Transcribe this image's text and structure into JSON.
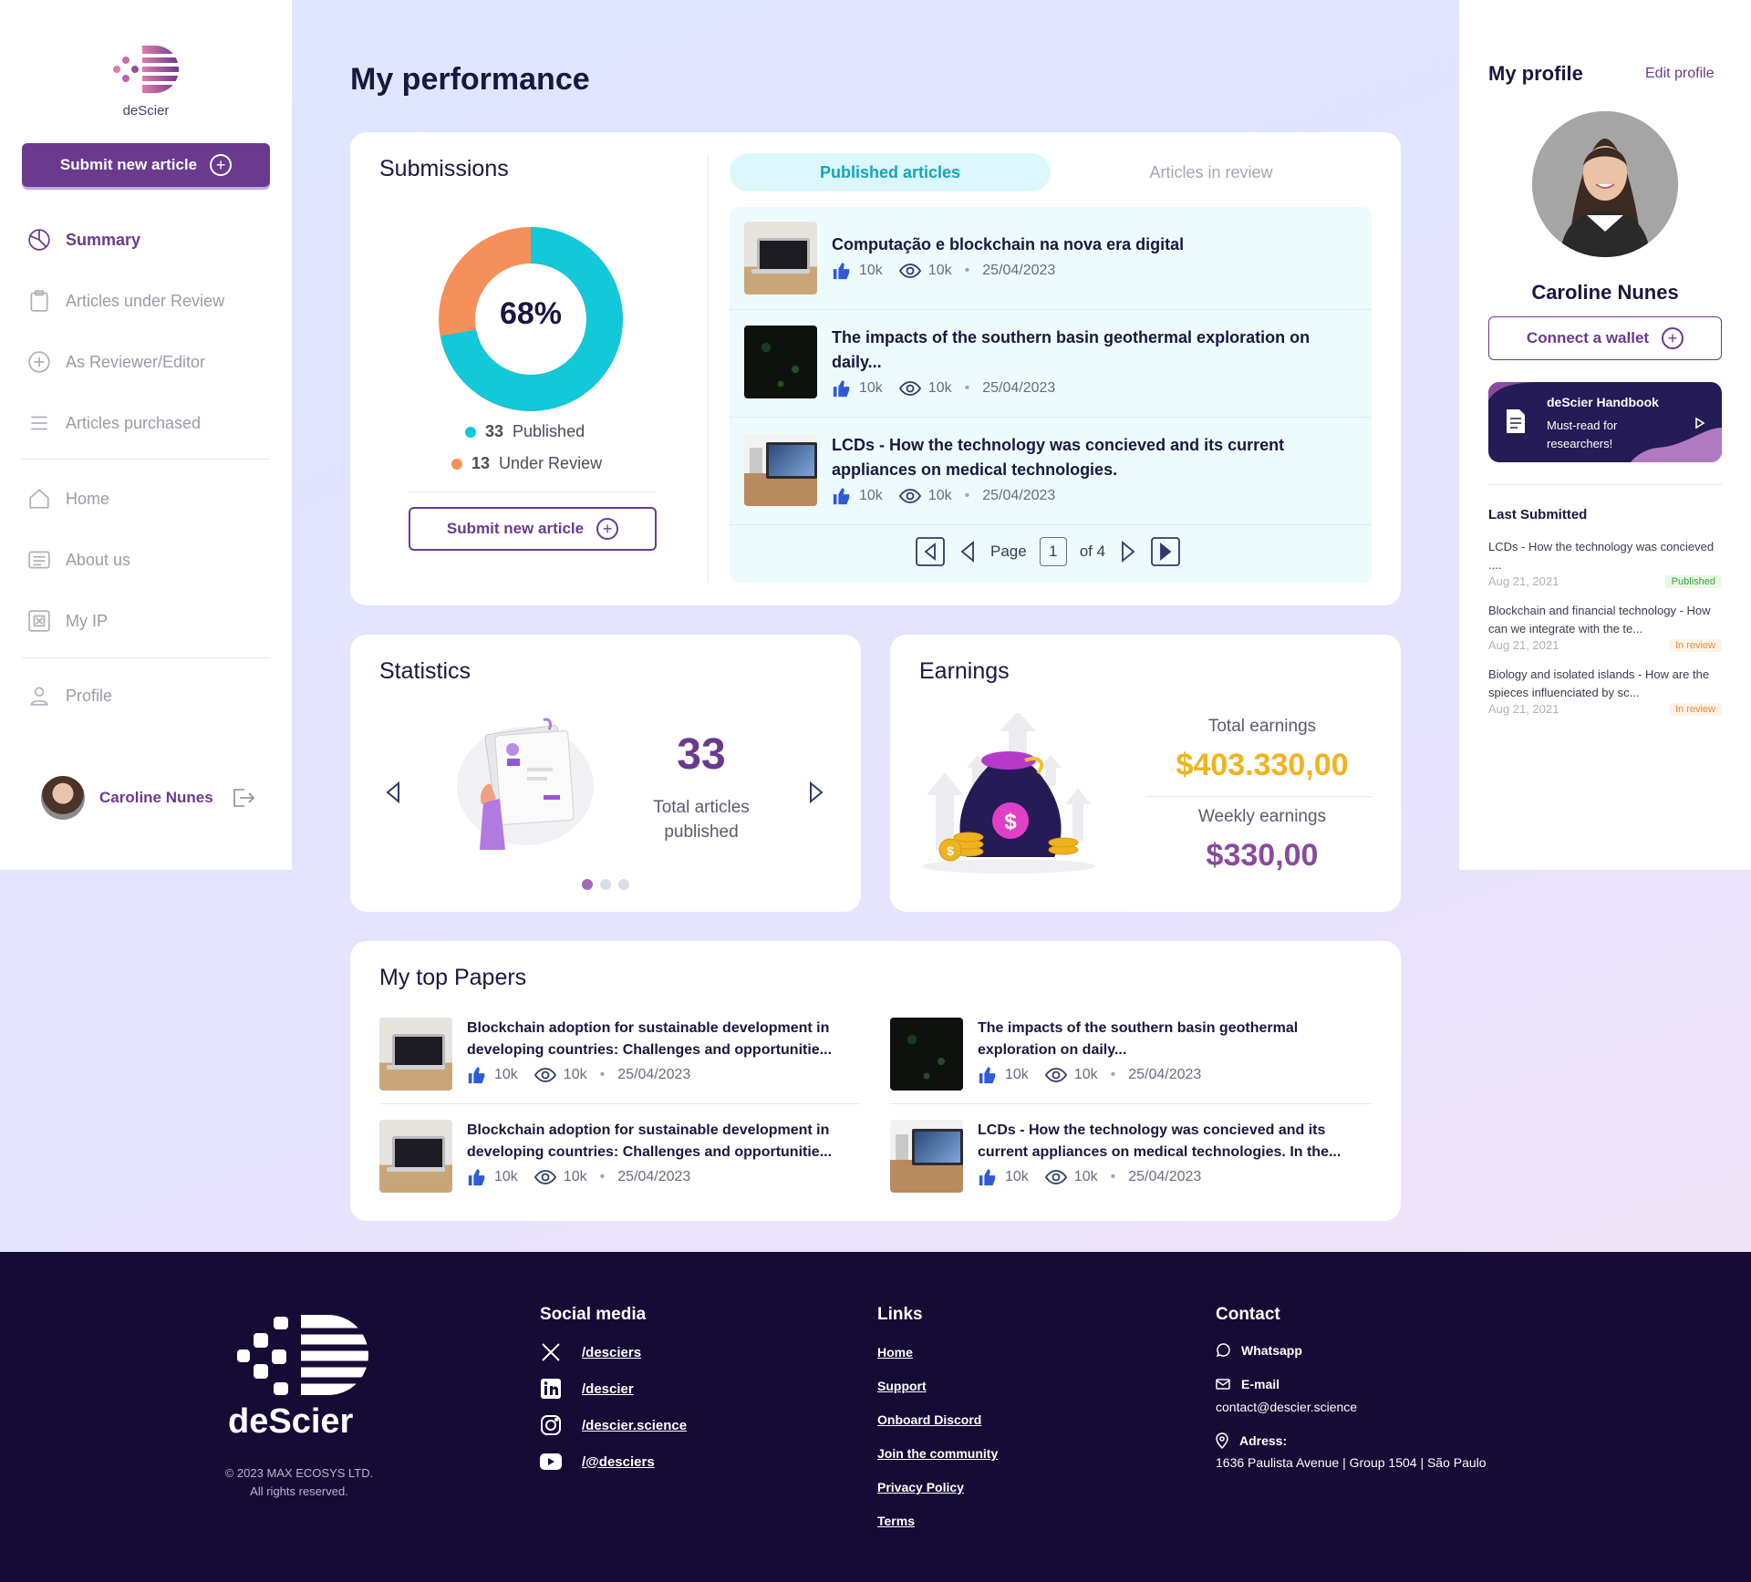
{
  "brand": {
    "name": "deScier",
    "accent": "#6a3a8f",
    "teal": "#13c8d8",
    "orange": "#f5905a",
    "gold": "#f0b320"
  },
  "sidebar": {
    "submit_label": "Submit new article",
    "nav": [
      {
        "label": "Summary",
        "icon": "pie-chart-icon",
        "active": true
      },
      {
        "label": "Articles under Review",
        "icon": "clipboard-icon"
      },
      {
        "label": "As Reviewer/Editor",
        "icon": "plus-circle-icon"
      },
      {
        "label": "Articles purchased",
        "icon": "list-icon"
      },
      {
        "label": "Home",
        "icon": "home-icon"
      },
      {
        "label": "About us",
        "icon": "document-icon"
      },
      {
        "label": "My IP",
        "icon": "ip-icon"
      },
      {
        "label": "Profile",
        "icon": "user-icon"
      }
    ],
    "user_name": "Caroline Nunes"
  },
  "main": {
    "title": "My performance",
    "submissions": {
      "title": "Submissions",
      "percent_label": "68%",
      "published_fraction": 0.72,
      "published_count": "33",
      "published_label": "Published",
      "review_count": "13",
      "review_label": "Under Review",
      "submit_label": "Submit new article"
    },
    "tabs": [
      {
        "label": "Published articles",
        "active": true
      },
      {
        "label": "Articles in review"
      }
    ],
    "articles": [
      {
        "title": "Computação e blockchain na nova era digital",
        "likes": "10k",
        "views": "10k",
        "date": "25/04/2023",
        "thumb": "laptop"
      },
      {
        "title": "The impacts of the southern basin geothermal exploration on daily...",
        "likes": "10k",
        "views": "10k",
        "date": "25/04/2023",
        "thumb": "dark"
      },
      {
        "title": "LCDs - How the technology was concieved and its current appliances on medical technologies.",
        "likes": "10k",
        "views": "10k",
        "date": "25/04/2023",
        "thumb": "desk"
      }
    ],
    "pagination": {
      "page_label": "Page",
      "current": "1",
      "of_label": "of 4"
    },
    "statistics": {
      "title": "Statistics",
      "number": "33",
      "caption": "Total articles published"
    },
    "earnings": {
      "title": "Earnings",
      "total_label": "Total earnings",
      "total_value": "$403.330,00",
      "weekly_label": "Weekly earnings",
      "weekly_value": "$330,00"
    },
    "top_papers": {
      "title": "My top Papers",
      "items": [
        {
          "title": "Blockchain adoption for sustainable development in developing countries: Challenges and opportunitie...",
          "likes": "10k",
          "views": "10k",
          "date": "25/04/2023",
          "thumb": "laptop"
        },
        {
          "title": "The impacts of the southern basin geothermal exploration on daily...",
          "likes": "10k",
          "views": "10k",
          "date": "25/04/2023",
          "thumb": "dark"
        },
        {
          "title": "Blockchain adoption for sustainable development in developing countries: Challenges and opportunitie...",
          "likes": "10k",
          "views": "10k",
          "date": "25/04/2023",
          "thumb": "laptop"
        },
        {
          "title": "LCDs - How the technology was concieved and its current appliances on medical technologies. In the...",
          "likes": "10k",
          "views": "10k",
          "date": "25/04/2023",
          "thumb": "desk"
        }
      ]
    }
  },
  "profile": {
    "title": "My profile",
    "edit_label": "Edit profile",
    "name": "Caroline Nunes",
    "wallet_label": "Connect a wallet",
    "handbook": {
      "title": "deScier Handbook",
      "text": "Must-read for researchers!"
    },
    "last_submitted_title": "Last Submitted",
    "last_submitted": [
      {
        "title": "LCDs - How the technology was concieved ....",
        "date": "Aug 21, 2021",
        "status": "Published"
      },
      {
        "title": "Blockchain and financial technology - How can we integrate with the te...",
        "date": "Aug 21, 2021",
        "status": "In review"
      },
      {
        "title": "Biology and isolated islands - How are the spieces influenciated by sc...",
        "date": "Aug 21, 2021",
        "status": "In review"
      }
    ]
  },
  "footer": {
    "brand": "deScier",
    "copyright": "© 2023 MAX ECOSYS LTD.",
    "rights": "All rights reserved.",
    "social_title": "Social media",
    "social": [
      {
        "icon": "x-icon",
        "label": "/desciers"
      },
      {
        "icon": "linkedin-icon",
        "label": "/descier"
      },
      {
        "icon": "instagram-icon",
        "label": "/descier.science"
      },
      {
        "icon": "youtube-icon",
        "label": "/@desciers"
      }
    ],
    "links_title": "Links",
    "links": [
      "Home",
      "Support",
      "Onboard Discord",
      "Join the community",
      "Privacy Policy",
      "Terms"
    ],
    "contact_title": "Contact",
    "whatsapp": "Whatsapp",
    "email_label": "E-mail",
    "email": "contact@descier.science",
    "address_label": "Adress:",
    "address": "1636 Paulista Avenue | Group 1504 | São Paulo"
  }
}
